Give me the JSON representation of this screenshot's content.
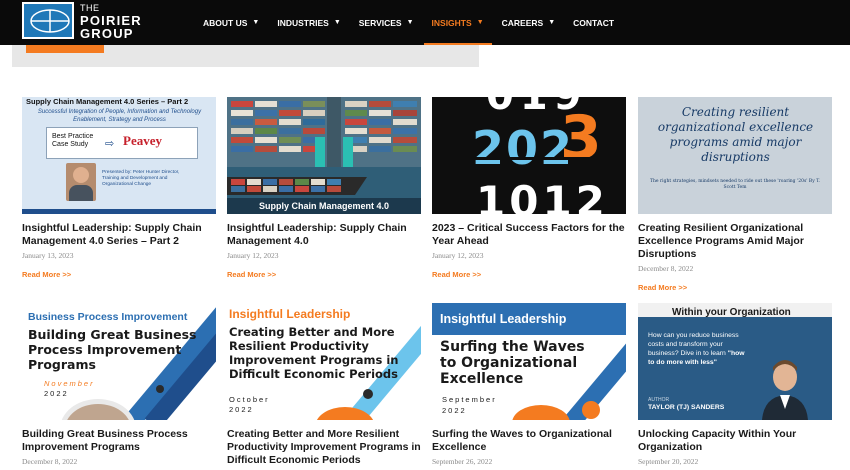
{
  "header": {
    "logo": {
      "line1": "THE",
      "line2": "POIRIER",
      "line3": "GROUP"
    },
    "nav": [
      {
        "label": "ABOUT US",
        "dropdown": true,
        "active": false
      },
      {
        "label": "INDUSTRIES",
        "dropdown": true,
        "active": false
      },
      {
        "label": "SERVICES",
        "dropdown": true,
        "active": false
      },
      {
        "label": "INSIGHTS",
        "dropdown": true,
        "active": true
      },
      {
        "label": "CAREERS",
        "dropdown": true,
        "active": false
      },
      {
        "label": "CONTACT",
        "dropdown": false,
        "active": false
      }
    ],
    "accent_color": "#f47b20"
  },
  "posts": [
    {
      "title": "Insightful Leadership: Supply Chain Management 4.0 Series – Part 2",
      "date": "January 13, 2023",
      "read_more": "Read More >>",
      "thumb": {
        "heading": "Supply Chain Management 4.0 Series – Part 2",
        "subheading": "Successful Integration of People, Information and Technology Enablement, Strategy and Process",
        "box_label": "Best Practice Case Study",
        "brand": "Peavey",
        "presenter": "Presented by: Peter Hunter Director, Training and Development and Organizational Change"
      }
    },
    {
      "title": "Insightful Leadership: Supply Chain Management 4.0",
      "date": "January 12, 2023",
      "read_more": "Read More >>",
      "thumb": {
        "caption": "Supply Chain Management 4.0"
      }
    },
    {
      "title": "2023 – Critical Success Factors for the Year Ahead",
      "date": "January 12, 2023",
      "read_more": "Read More >>",
      "thumb": {
        "top": "019",
        "year": "202",
        "accent": "3",
        "bottom": "1012"
      }
    },
    {
      "title": "Creating Resilient Organizational Excellence Programs Amid Major Disruptions",
      "date": "December 8, 2022",
      "read_more": "Read More >>",
      "thumb": {
        "text": "Creating resilient organizational excellence programs amid major disruptions",
        "small": "The right strategies, mindsets needed to ride out these 'roaring '20s' By T. Scott Tem"
      }
    },
    {
      "title": "Building Great Business Process Improvement Programs",
      "date": "December 8, 2022",
      "thumb": {
        "kicker": "Business Process Improvement",
        "headline": "Building Great Business Process Improvement Programs",
        "month": "November",
        "year": "2022"
      }
    },
    {
      "title": "Creating Better and More Resilient Productivity Improvement Programs in Difficult Economic Periods",
      "thumb": {
        "kicker": "Insightful Leadership",
        "headline": "Creating Better and More Resilient Productivity Improvement Programs in Difficult Economic Periods",
        "month": "October",
        "year": "2022"
      }
    },
    {
      "title": "Surfing the Waves to Organizational Excellence",
      "date": "September 26, 2022",
      "thumb": {
        "kicker": "Insightful Leadership",
        "headline": "Surfing the Waves to Organizational Excellence",
        "month": "September",
        "year": "2022"
      }
    },
    {
      "title": "Unlocking Capacity Within Your Organization",
      "date": "September 20, 2022",
      "thumb": {
        "headline": "Within your Organization",
        "body": "How can you reduce business costs and transform your business? Dive in to learn",
        "body_bold": "\"how to do more with less\"",
        "author_label": "AUTHOR",
        "author": "TAYLOR (TJ) SANDERS"
      }
    }
  ]
}
